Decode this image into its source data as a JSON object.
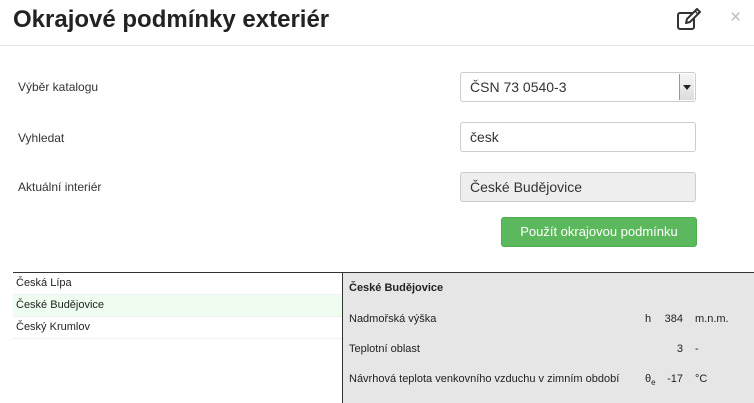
{
  "dialog": {
    "title": "Okrajové podmínky exteriér"
  },
  "form": {
    "catalog_label": "Výběr katalogu",
    "catalog_value": "ČSN 73 0540-3",
    "search_label": "Vyhledat",
    "search_value": "česk",
    "current_label": "Aktuální interiér",
    "current_value": "České Budějovice",
    "apply_label": "Použít okrajovou podmínku"
  },
  "list": {
    "items": [
      {
        "label": "Česká Lípa",
        "selected": false
      },
      {
        "label": "České Budějovice",
        "selected": true
      },
      {
        "label": "Český Krumlov",
        "selected": false
      }
    ]
  },
  "detail": {
    "title": "České Budějovice",
    "rows": [
      {
        "label": "Nadmořská výška",
        "symbol": "h",
        "symbol_sub": "",
        "value": "384",
        "unit": "m.n.m."
      },
      {
        "label": "Teplotní oblast",
        "symbol": "",
        "symbol_sub": "",
        "value": "3",
        "unit": "-"
      },
      {
        "label": "Návrhová teplota venkovního vzduchu v zimním období",
        "symbol": "θ",
        "symbol_sub": "e",
        "value": "-17",
        "unit": "°C"
      }
    ]
  },
  "icons": {
    "edit": "edit-icon",
    "close": "close-icon"
  },
  "colors": {
    "accent_button": "#5cb85c",
    "selected_row": "#eefdf0",
    "detail_panel": "#e6e6e6"
  }
}
